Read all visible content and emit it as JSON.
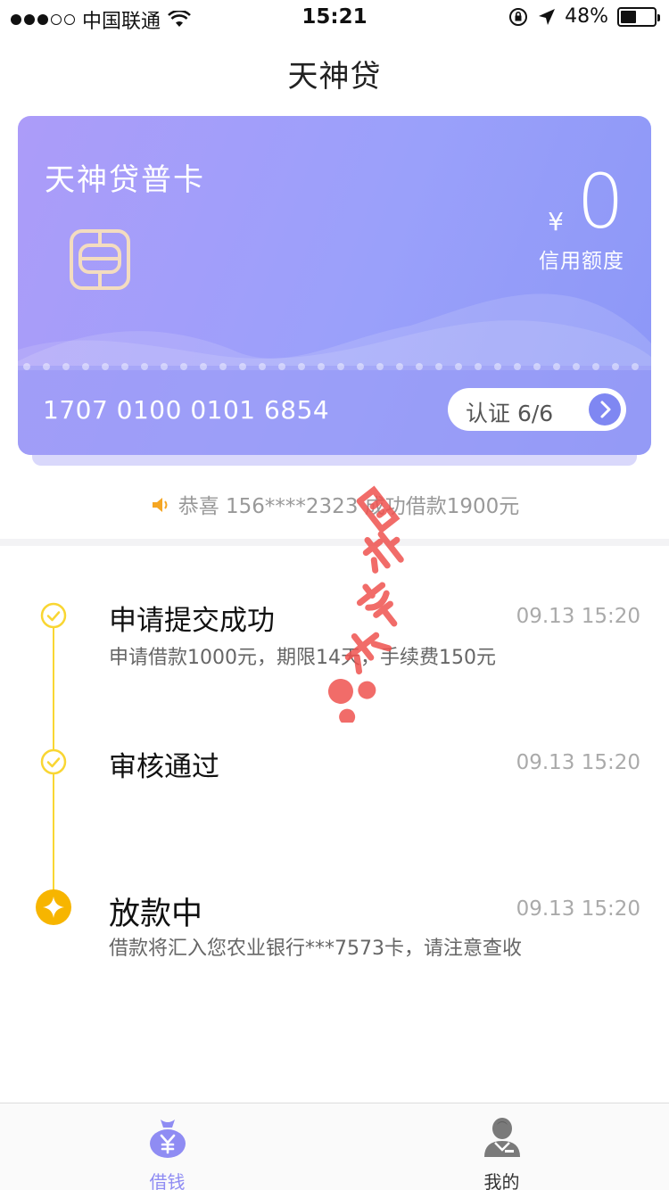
{
  "status_bar": {
    "carrier": "中国联通",
    "time": "15:21",
    "battery": "48%",
    "battery_level": 0.48
  },
  "nav": {
    "title": "天神贷"
  },
  "card": {
    "title": "天神贷普卡",
    "currency": "¥",
    "limit_value": "0",
    "limit_label": "信用额度",
    "number": "1707 0100 0101 6854",
    "verify_label": "认证 6/6"
  },
  "notice": {
    "text": "恭喜 156****2323 成功借款1900元"
  },
  "timeline": [
    {
      "title": "申请提交成功",
      "time": "09.13 15:20",
      "desc": "申请借款1000元，期限14天，手续费150元"
    },
    {
      "title": "审核通过",
      "time": "09.13 15:20",
      "desc": ""
    },
    {
      "title": "放款中",
      "time": "09.13 15:20",
      "desc": "借款将汇入您农业银行***7573卡，请注意查收"
    }
  ],
  "tabs": [
    {
      "label": "借钱",
      "icon": "money-bag-icon",
      "active": true
    },
    {
      "label": "我的",
      "icon": "user-icon",
      "active": false
    }
  ],
  "colors": {
    "accent": "#7f87f2",
    "timeline": "#f9d633",
    "active_step": "#f7b500",
    "notice_icon": "#f5a623"
  }
}
